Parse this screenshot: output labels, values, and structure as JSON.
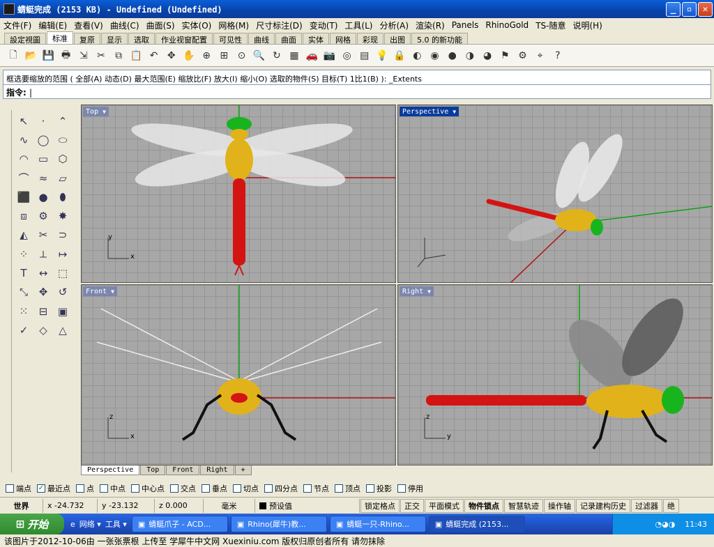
{
  "window": {
    "title": "蜻蜓完成 (2153 KB) - Undefined (Undefined)",
    "min_glyph": "_",
    "max_glyph": "▫",
    "close_glyph": "✕"
  },
  "menu": [
    "文件(F)",
    "编辑(E)",
    "查看(V)",
    "曲线(C)",
    "曲面(S)",
    "实体(O)",
    "网格(M)",
    "尺寸标注(D)",
    "变动(T)",
    "工具(L)",
    "分析(A)",
    "渲染(R)",
    "Panels",
    "RhinoGold",
    "TS-随意",
    "说明(H)"
  ],
  "toolbar_tabs": [
    {
      "label": "設定視圖",
      "active": false
    },
    {
      "label": "标准",
      "active": true
    },
    {
      "label": "复原",
      "active": false
    },
    {
      "label": "显示",
      "active": false
    },
    {
      "label": "选取",
      "active": false
    },
    {
      "label": "作业视窗配置",
      "active": false
    },
    {
      "label": "可见性",
      "active": false
    },
    {
      "label": "曲线",
      "active": false
    },
    {
      "label": "曲面",
      "active": false
    },
    {
      "label": "实体",
      "active": false
    },
    {
      "label": "网格",
      "active": false
    },
    {
      "label": "彩现",
      "active": false
    },
    {
      "label": "出图",
      "active": false
    },
    {
      "label": "5.0 的新功能",
      "active": false
    }
  ],
  "toolbar_icons": [
    "new-file-icon",
    "open-folder-icon",
    "save-icon",
    "print-icon",
    "import-icon",
    "cut-icon",
    "copy-icon",
    "paste-icon",
    "undo-icon",
    "pan-icon",
    "hand-icon",
    "zoom-window-icon",
    "zoom-extents-icon",
    "zoom-selected-icon",
    "zoom-icon",
    "rotate-view-icon",
    "four-viewports-icon",
    "car-icon",
    "camera-icon",
    "target-icon",
    "layer-icon",
    "lightbulb-icon",
    "lock-icon",
    "material-icon",
    "color-wheel-icon",
    "shaded-sphere-icon",
    "render-sphere-icon",
    "gloss-sphere-icon",
    "draw-order-icon",
    "settings-icon",
    "snap-icon",
    "help-icon"
  ],
  "command": {
    "history": "框选要缩放的范围 ( 全部(A)  动态(D)  最大范围(E)  缩放比(F)  放大(I)  缩小(O)  选取的物件(S)  目标(T)  1比1(B) ): _Extents",
    "prompt": "指令:",
    "caret": "|"
  },
  "side_icons": [
    "select-arrow-icon",
    "point-icon",
    "polyline-icon",
    "curve-icon",
    "circle-icon",
    "ellipse-icon",
    "arc-icon",
    "rectangle-icon",
    "polygon-icon",
    "fillet-icon",
    "free-form-icon",
    "surface-icon",
    "box-icon",
    "sphere-icon",
    "cylinder-icon",
    "mesh-icon",
    "gear-icon",
    "explode-icon",
    "boolean-icon",
    "trim-icon",
    "join-icon",
    "array-icon",
    "offset-icon",
    "extend-icon",
    "text-icon",
    "dimension-icon",
    "group-icon",
    "scale-icon",
    "move-icon",
    "rotate-icon",
    "grid-icon",
    "align-icon",
    "snapshot-icon",
    "check-icon",
    "analyze-icon",
    "render-icon"
  ],
  "viewports": [
    {
      "label": "Top",
      "active": false
    },
    {
      "label": "Perspective",
      "active": true
    },
    {
      "label": "Front",
      "active": false
    },
    {
      "label": "Right",
      "active": false
    }
  ],
  "axis": {
    "x": "x",
    "y": "y",
    "z": "z"
  },
  "viewport_tabs": [
    {
      "label": "Perspective",
      "active": true
    },
    {
      "label": "Top",
      "active": false
    },
    {
      "label": "Front",
      "active": false
    },
    {
      "label": "Right",
      "active": false
    },
    {
      "label": "+",
      "active": false
    }
  ],
  "osnaps": [
    {
      "label": "端点",
      "checked": false
    },
    {
      "label": "最近点",
      "checked": true
    },
    {
      "label": "点",
      "checked": false
    },
    {
      "label": "中点",
      "checked": false
    },
    {
      "label": "中心点",
      "checked": false
    },
    {
      "label": "交点",
      "checked": false
    },
    {
      "label": "垂点",
      "checked": false
    },
    {
      "label": "切点",
      "checked": false
    },
    {
      "label": "四分点",
      "checked": false
    },
    {
      "label": "节点",
      "checked": false
    },
    {
      "label": "顶点",
      "checked": false
    },
    {
      "label": "投影",
      "checked": false
    },
    {
      "label": "停用",
      "checked": false
    }
  ],
  "status": {
    "cplane": "世界",
    "x": "x -24.732",
    "y": "y -23.132",
    "z": "z 0.000",
    "units": "毫米",
    "layer": "预设值",
    "buttons": [
      "锁定格点",
      "正交",
      "平面模式",
      "物件锁点",
      "智慧轨迹",
      "操作轴",
      "记录建构历史",
      "过滤器",
      "绝"
    ]
  },
  "taskbar": {
    "start": "开始",
    "quicklaunch": [
      "网络",
      "工具"
    ],
    "tasks": [
      {
        "label": "蜻蜓爪子 - ACD...",
        "active": false
      },
      {
        "label": "Rhino(犀牛)教...",
        "active": false
      },
      {
        "label": "蜻蜓一只-Rhino...",
        "active": false
      },
      {
        "label": "蜻蜓完成 (2153...",
        "active": true
      }
    ],
    "clock": "11:43"
  },
  "caption": "该图片于2012-10-06由 一张张票根 上传至 学犀牛中文网 Xuexiniu.com 版权归原创者所有 请勿抹除",
  "colors": {
    "title_bar": "#0a49c0",
    "wing": "#e8e8e8",
    "body": "#e1b21a",
    "tail": "#d41313",
    "eyes": "#18b41d",
    "axis_red": "#b01010",
    "axis_green": "#10a010"
  }
}
